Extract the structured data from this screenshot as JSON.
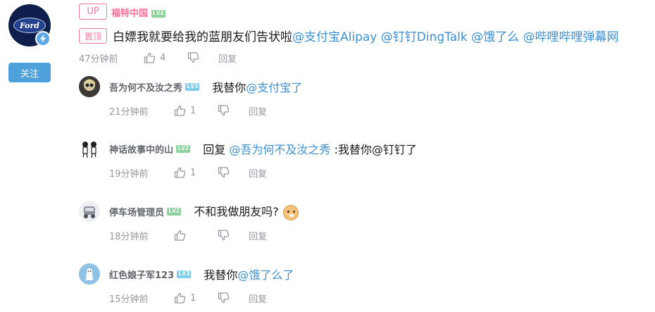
{
  "main_comment": {
    "up_badge": "UP",
    "author": "福特中国",
    "author_level": "LV2",
    "pin_badge": "置顶",
    "text_prefix": "白嫖我就要给我的蓝朋友们告状啦",
    "mentions": [
      "@支付宝Alipay",
      "@钉钉DingTalk",
      "@饿了么",
      "@哔哩哔哩弹幕网"
    ],
    "time": "47分钟前",
    "likes": "4",
    "reply_label": "回复"
  },
  "follow_button": "关注",
  "avatar_logo_text": "Ford",
  "replies": [
    {
      "author": "吾为何不及汝之秀",
      "level": "LV3",
      "text_prefix": "我替你",
      "mention": "@支付宝了",
      "text_suffix": "",
      "time": "21分钟前",
      "likes": "1",
      "reply_label": "回复"
    },
    {
      "author": "神话故事中的山",
      "level": "LV2",
      "text_prefix": "回复 ",
      "mention": "@吾为何不及汝之秀",
      "text_suffix": " :我替你@钉钉了",
      "time": "19分钟前",
      "likes": "1",
      "reply_label": "回复"
    },
    {
      "author": "停车场管理员",
      "level": "LV2",
      "text_prefix": "不和我做朋友吗?",
      "mention": "",
      "text_suffix": "",
      "emoji": "doge",
      "time": "18分钟前",
      "likes": "",
      "reply_label": "回复"
    },
    {
      "author": "红色娘子军123",
      "level": "LV3",
      "text_prefix": "我替你",
      "mention": "@饿了么了",
      "text_suffix": "",
      "time": "15分钟前",
      "likes": "1",
      "reply_label": "回复"
    }
  ],
  "colors": {
    "accent_pink": "#fb7299",
    "mention_blue": "#3b8fd1",
    "follow_blue": "#4fa1dc",
    "meta_gray": "#9499a0"
  },
  "icons": [
    "ford-logo-avatar",
    "verified-badge-icon",
    "thumb-up-icon",
    "thumb-down-icon",
    "doge-emoji"
  ]
}
